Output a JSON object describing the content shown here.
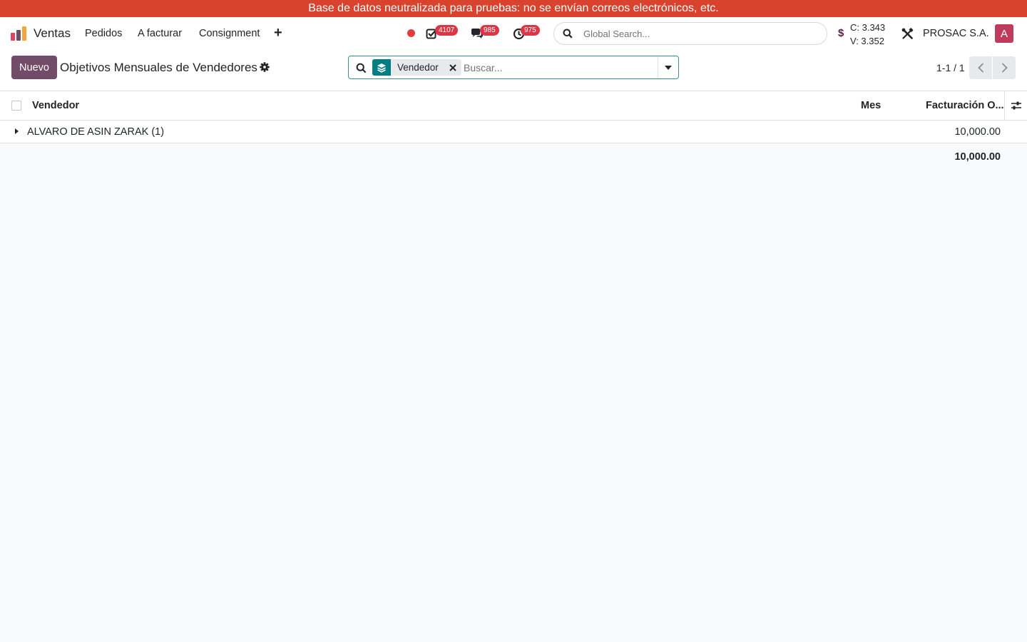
{
  "banner": {
    "text": "Base de datos neutralizada para pruebas: no se envían correos electrónicos, etc."
  },
  "navbar": {
    "app_name": "Ventas",
    "menu": [
      "Pedidos",
      "A facturar",
      "Consignment"
    ],
    "badges": {
      "activities": "4107",
      "messages": "985",
      "timers": "975"
    },
    "global_search_placeholder": "Global Search...",
    "currency_symbol": "$",
    "rate_buy": "C: 3.343",
    "rate_sell": "V: 3.352",
    "company": "PROSAC S.A.",
    "avatar_letter": "A"
  },
  "control_panel": {
    "new_button": "Nuevo",
    "title": "Objetivos Mensuales de Vendedores",
    "facet_label": "Vendedor",
    "search_placeholder": "Buscar...",
    "pager": "1-1 / 1"
  },
  "list": {
    "columns": [
      "Vendedor",
      "Mes",
      "Facturación O..."
    ],
    "groups": [
      {
        "label": "ALVARO DE ASIN ZARAK (1)",
        "total": "10,000.00"
      }
    ],
    "grand_total": "10,000.00"
  },
  "colors": {
    "banner": "#d9432e",
    "primary": "#714b67",
    "facet": "#017e84",
    "badge": "#dc3545"
  }
}
